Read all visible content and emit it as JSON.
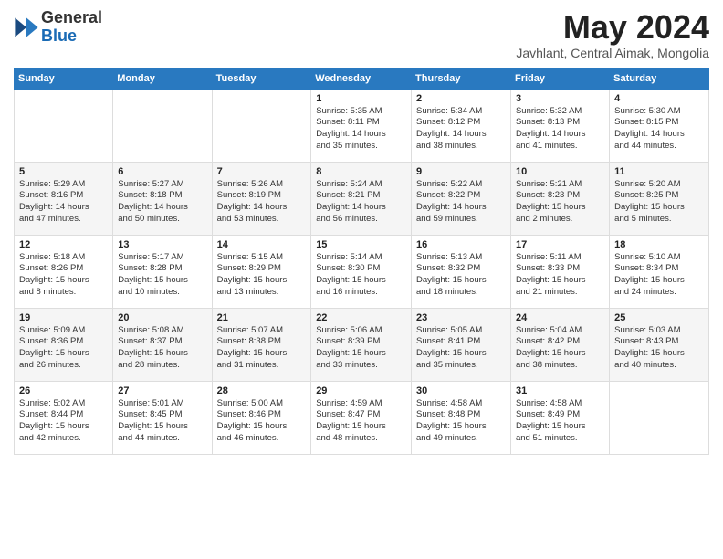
{
  "logo": {
    "general": "General",
    "blue": "Blue"
  },
  "title": "May 2024",
  "location": "Javhlant, Central Aimak, Mongolia",
  "weekdays": [
    "Sunday",
    "Monday",
    "Tuesday",
    "Wednesday",
    "Thursday",
    "Friday",
    "Saturday"
  ],
  "weeks": [
    [
      {
        "day": "",
        "info": ""
      },
      {
        "day": "",
        "info": ""
      },
      {
        "day": "",
        "info": ""
      },
      {
        "day": "1",
        "info": "Sunrise: 5:35 AM\nSunset: 8:11 PM\nDaylight: 14 hours\nand 35 minutes."
      },
      {
        "day": "2",
        "info": "Sunrise: 5:34 AM\nSunset: 8:12 PM\nDaylight: 14 hours\nand 38 minutes."
      },
      {
        "day": "3",
        "info": "Sunrise: 5:32 AM\nSunset: 8:13 PM\nDaylight: 14 hours\nand 41 minutes."
      },
      {
        "day": "4",
        "info": "Sunrise: 5:30 AM\nSunset: 8:15 PM\nDaylight: 14 hours\nand 44 minutes."
      }
    ],
    [
      {
        "day": "5",
        "info": "Sunrise: 5:29 AM\nSunset: 8:16 PM\nDaylight: 14 hours\nand 47 minutes."
      },
      {
        "day": "6",
        "info": "Sunrise: 5:27 AM\nSunset: 8:18 PM\nDaylight: 14 hours\nand 50 minutes."
      },
      {
        "day": "7",
        "info": "Sunrise: 5:26 AM\nSunset: 8:19 PM\nDaylight: 14 hours\nand 53 minutes."
      },
      {
        "day": "8",
        "info": "Sunrise: 5:24 AM\nSunset: 8:21 PM\nDaylight: 14 hours\nand 56 minutes."
      },
      {
        "day": "9",
        "info": "Sunrise: 5:22 AM\nSunset: 8:22 PM\nDaylight: 14 hours\nand 59 minutes."
      },
      {
        "day": "10",
        "info": "Sunrise: 5:21 AM\nSunset: 8:23 PM\nDaylight: 15 hours\nand 2 minutes."
      },
      {
        "day": "11",
        "info": "Sunrise: 5:20 AM\nSunset: 8:25 PM\nDaylight: 15 hours\nand 5 minutes."
      }
    ],
    [
      {
        "day": "12",
        "info": "Sunrise: 5:18 AM\nSunset: 8:26 PM\nDaylight: 15 hours\nand 8 minutes."
      },
      {
        "day": "13",
        "info": "Sunrise: 5:17 AM\nSunset: 8:28 PM\nDaylight: 15 hours\nand 10 minutes."
      },
      {
        "day": "14",
        "info": "Sunrise: 5:15 AM\nSunset: 8:29 PM\nDaylight: 15 hours\nand 13 minutes."
      },
      {
        "day": "15",
        "info": "Sunrise: 5:14 AM\nSunset: 8:30 PM\nDaylight: 15 hours\nand 16 minutes."
      },
      {
        "day": "16",
        "info": "Sunrise: 5:13 AM\nSunset: 8:32 PM\nDaylight: 15 hours\nand 18 minutes."
      },
      {
        "day": "17",
        "info": "Sunrise: 5:11 AM\nSunset: 8:33 PM\nDaylight: 15 hours\nand 21 minutes."
      },
      {
        "day": "18",
        "info": "Sunrise: 5:10 AM\nSunset: 8:34 PM\nDaylight: 15 hours\nand 24 minutes."
      }
    ],
    [
      {
        "day": "19",
        "info": "Sunrise: 5:09 AM\nSunset: 8:36 PM\nDaylight: 15 hours\nand 26 minutes."
      },
      {
        "day": "20",
        "info": "Sunrise: 5:08 AM\nSunset: 8:37 PM\nDaylight: 15 hours\nand 28 minutes."
      },
      {
        "day": "21",
        "info": "Sunrise: 5:07 AM\nSunset: 8:38 PM\nDaylight: 15 hours\nand 31 minutes."
      },
      {
        "day": "22",
        "info": "Sunrise: 5:06 AM\nSunset: 8:39 PM\nDaylight: 15 hours\nand 33 minutes."
      },
      {
        "day": "23",
        "info": "Sunrise: 5:05 AM\nSunset: 8:41 PM\nDaylight: 15 hours\nand 35 minutes."
      },
      {
        "day": "24",
        "info": "Sunrise: 5:04 AM\nSunset: 8:42 PM\nDaylight: 15 hours\nand 38 minutes."
      },
      {
        "day": "25",
        "info": "Sunrise: 5:03 AM\nSunset: 8:43 PM\nDaylight: 15 hours\nand 40 minutes."
      }
    ],
    [
      {
        "day": "26",
        "info": "Sunrise: 5:02 AM\nSunset: 8:44 PM\nDaylight: 15 hours\nand 42 minutes."
      },
      {
        "day": "27",
        "info": "Sunrise: 5:01 AM\nSunset: 8:45 PM\nDaylight: 15 hours\nand 44 minutes."
      },
      {
        "day": "28",
        "info": "Sunrise: 5:00 AM\nSunset: 8:46 PM\nDaylight: 15 hours\nand 46 minutes."
      },
      {
        "day": "29",
        "info": "Sunrise: 4:59 AM\nSunset: 8:47 PM\nDaylight: 15 hours\nand 48 minutes."
      },
      {
        "day": "30",
        "info": "Sunrise: 4:58 AM\nSunset: 8:48 PM\nDaylight: 15 hours\nand 49 minutes."
      },
      {
        "day": "31",
        "info": "Sunrise: 4:58 AM\nSunset: 8:49 PM\nDaylight: 15 hours\nand 51 minutes."
      },
      {
        "day": "",
        "info": ""
      }
    ]
  ]
}
